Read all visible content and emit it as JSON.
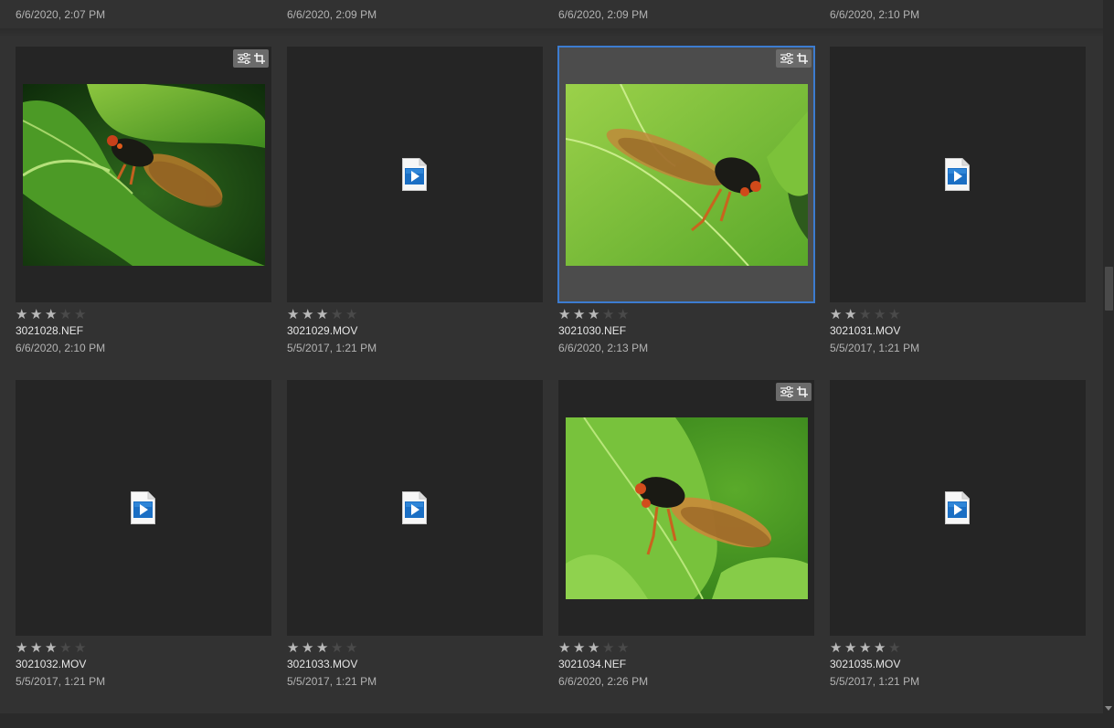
{
  "top_row_dates": [
    "6/6/2020, 2:07 PM",
    "6/6/2020, 2:09 PM",
    "6/6/2020, 2:09 PM",
    "6/6/2020, 2:10 PM"
  ],
  "items": [
    {
      "filename": "3021028.NEF",
      "date": "6/6/2020, 2:10 PM",
      "rating": 3,
      "type": "photo",
      "edited": true,
      "selected": false,
      "image": "cicada-on-leaf-dark-background"
    },
    {
      "filename": "3021029.MOV",
      "date": "5/5/2017, 1:21 PM",
      "rating": 3,
      "type": "video",
      "edited": false,
      "selected": false
    },
    {
      "filename": "3021030.NEF",
      "date": "6/6/2020, 2:13 PM",
      "rating": 3,
      "type": "photo",
      "edited": true,
      "selected": true,
      "image": "cicada-on-bright-leaf"
    },
    {
      "filename": "3021031.MOV",
      "date": "5/5/2017, 1:21 PM",
      "rating": 2,
      "type": "video",
      "edited": false,
      "selected": false
    },
    {
      "filename": "3021032.MOV",
      "date": "5/5/2017, 1:21 PM",
      "rating": 3,
      "type": "video",
      "edited": false,
      "selected": false
    },
    {
      "filename": "3021033.MOV",
      "date": "5/5/2017, 1:21 PM",
      "rating": 3,
      "type": "video",
      "edited": false,
      "selected": false
    },
    {
      "filename": "3021034.NEF",
      "date": "6/6/2020, 2:26 PM",
      "rating": 3,
      "type": "photo",
      "edited": true,
      "selected": false,
      "image": "cicada-on-leaf-green-background"
    },
    {
      "filename": "3021035.MOV",
      "date": "5/5/2017, 1:21 PM",
      "rating": 4,
      "type": "video",
      "edited": false,
      "selected": false
    }
  ],
  "max_rating": 5,
  "colors": {
    "background": "#323232",
    "tile": "#252525",
    "selected_tile": "#4c4c4c",
    "selection_outline": "#3c7cd0",
    "star_on": "#b9b9b9",
    "star_off": "#4a4a4a",
    "video_icon": "#1b6fc4"
  },
  "icons": {
    "edit_badge": [
      "sliders-icon",
      "crop-icon"
    ],
    "video": "video-file-icon",
    "star": "star-icon"
  }
}
